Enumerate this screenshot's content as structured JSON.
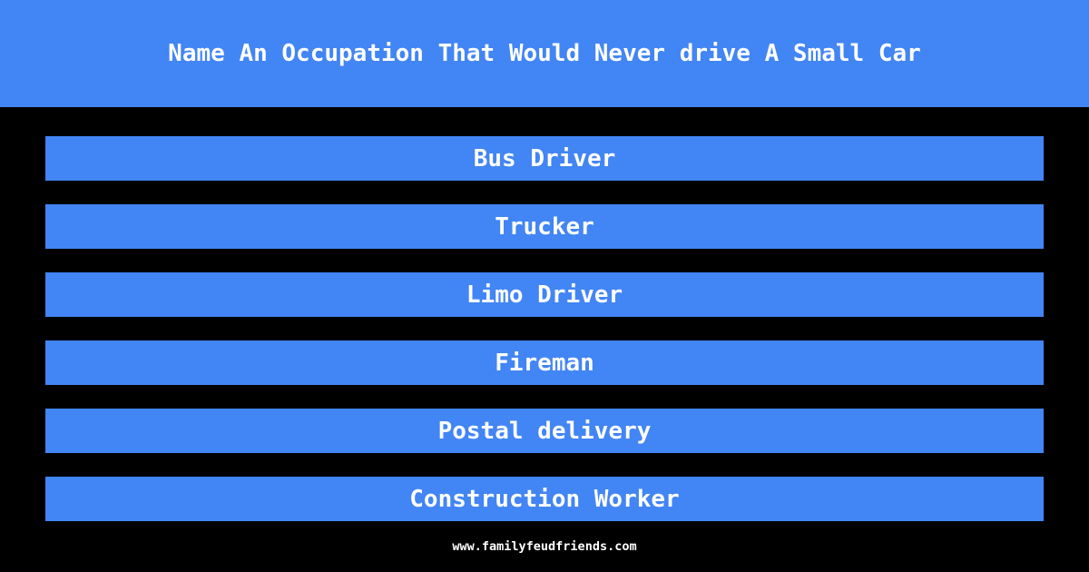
{
  "header": {
    "title": "Name An Occupation That Would Never drive A Small Car",
    "background_color": "#4285f4",
    "text_color": "#ffffff"
  },
  "answers": {
    "bar_color": "#4285f4",
    "text_color": "#ffffff",
    "items": [
      {
        "label": "Bus Driver"
      },
      {
        "label": "Trucker"
      },
      {
        "label": "Limo Driver"
      },
      {
        "label": "Fireman"
      },
      {
        "label": "Postal delivery"
      },
      {
        "label": "Construction Worker"
      }
    ]
  },
  "footer": {
    "site": "www.familyfeudfriends.com",
    "text_color": "#ffffff",
    "background_color": "#000000"
  },
  "page": {
    "background_color": "#000000"
  }
}
